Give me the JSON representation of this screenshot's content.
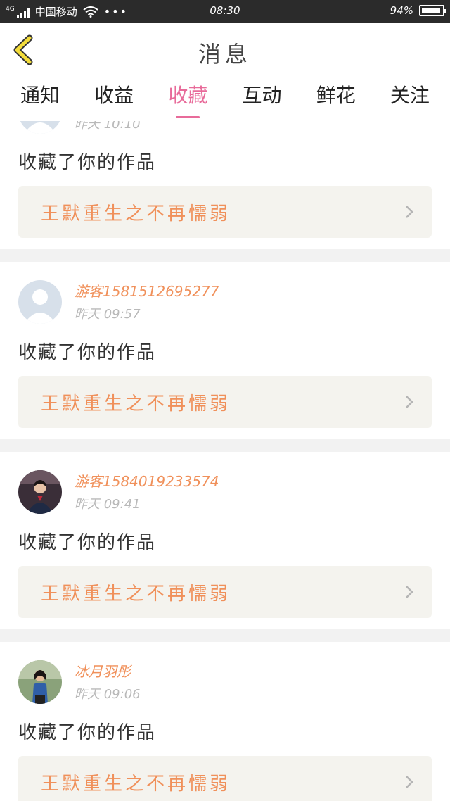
{
  "status_bar": {
    "network": "4G",
    "carrier": "中国移动",
    "dots": "•••",
    "time": "08:30",
    "battery": "94%",
    "battery_level": 0.94
  },
  "header": {
    "title": "消息",
    "back_icon": "chevron-left-icon"
  },
  "tabs": [
    {
      "label": "通知",
      "active": false
    },
    {
      "label": "收益",
      "active": false
    },
    {
      "label": "收藏",
      "active": true
    },
    {
      "label": "互动",
      "active": false
    },
    {
      "label": "鲜花",
      "active": false
    },
    {
      "label": "关注",
      "active": false
    }
  ],
  "colors": {
    "accent": "#e86b9a",
    "username": "#f0905a",
    "work_title": "#f0905a"
  },
  "items": [
    {
      "username": "",
      "time": "昨天 10:10",
      "action": "收藏了你的作品",
      "work_title": "王默重生之不再懦弱",
      "avatar": "default-avatar"
    },
    {
      "username": "游客1581512695277",
      "time": "昨天 09:57",
      "action": "收藏了你的作品",
      "work_title": "王默重生之不再懦弱",
      "avatar": "default-avatar"
    },
    {
      "username": "游客1584019233574",
      "time": "昨天 09:41",
      "action": "收藏了你的作品",
      "work_title": "王默重生之不再懦弱",
      "avatar": "photo-avatar"
    },
    {
      "username": "冰月羽彤",
      "time": "昨天 09:06",
      "action": "收藏了你的作品",
      "work_title": "王默重生之不再懦弱",
      "avatar": "photo-avatar"
    }
  ]
}
